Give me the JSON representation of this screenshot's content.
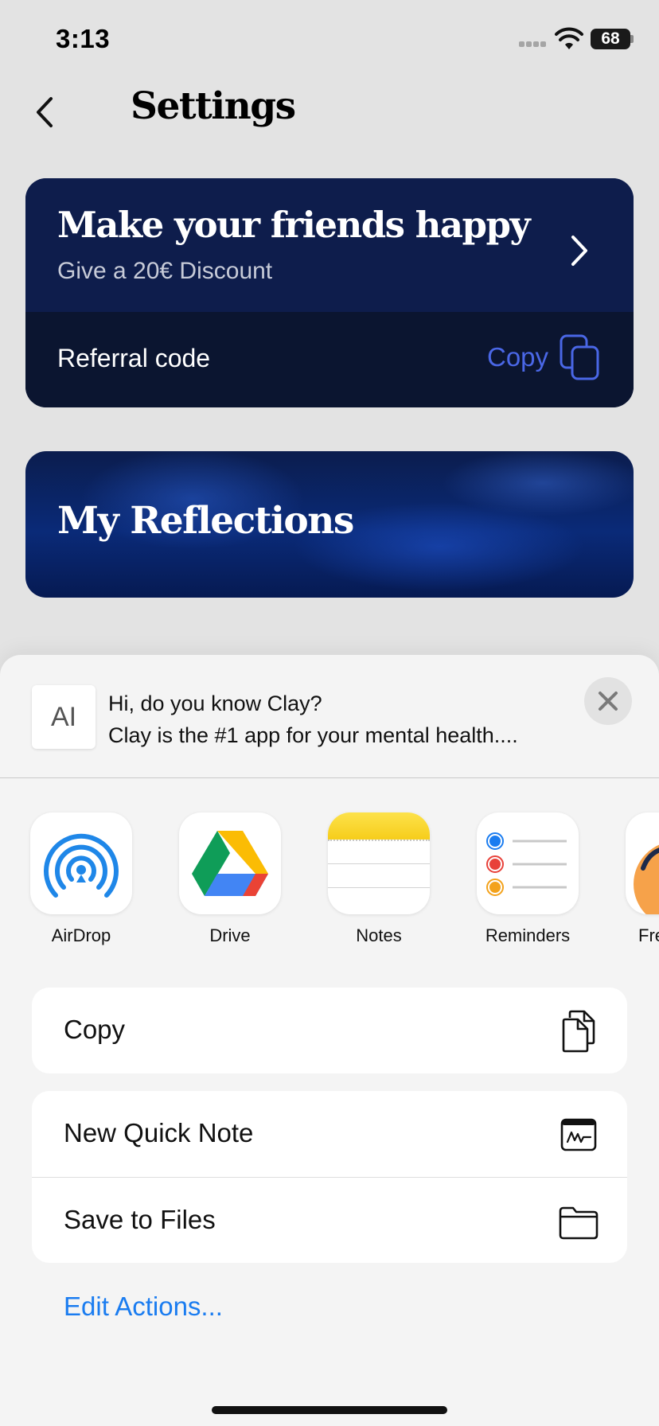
{
  "status_bar": {
    "time": "3:13",
    "battery": "68"
  },
  "header": {
    "title": "Settings",
    "back_icon": "chevron-left-icon"
  },
  "referral_card": {
    "title": "Make your friends happy",
    "subtitle": "Give a 20€ Discount",
    "code_label": "Referral code",
    "copy_label": "Copy",
    "background": "#0e1d4c",
    "accent": "#4a67e6"
  },
  "reflections_card": {
    "title": "My Reflections"
  },
  "share_sheet": {
    "preview": {
      "thumb_text": "AI",
      "line1": "Hi, do you know Clay?",
      "line2": "Clay is the #1 app for your mental health...."
    },
    "apps": [
      {
        "label": "AirDrop",
        "icon": "airdrop-icon"
      },
      {
        "label": "Drive",
        "icon": "google-drive-icon"
      },
      {
        "label": "Notes",
        "icon": "notes-icon"
      },
      {
        "label": "Reminders",
        "icon": "reminders-icon"
      },
      {
        "label": "Fre",
        "icon": "freeform-icon"
      }
    ],
    "actions_group1": [
      {
        "label": "Copy",
        "icon": "copy-icon"
      }
    ],
    "actions_group2": [
      {
        "label": "New Quick Note",
        "icon": "quick-note-icon"
      },
      {
        "label": "Save to Files",
        "icon": "folder-icon"
      }
    ],
    "edit_actions": "Edit Actions...",
    "link_color": "#1a7cf0"
  }
}
